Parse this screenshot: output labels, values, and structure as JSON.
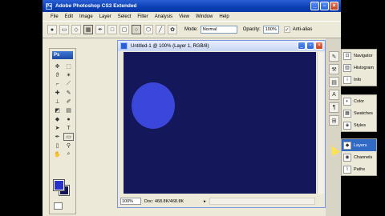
{
  "window": {
    "title": "Adobe Photoshop CS3 Extended",
    "app_icon": "Ps"
  },
  "menu": [
    "File",
    "Edit",
    "Image",
    "Layer",
    "Select",
    "Filter",
    "Analysis",
    "View",
    "Window",
    "Help"
  ],
  "options": {
    "mode_label": "Mode:",
    "mode_value": "Normal",
    "opacity_label": "Opacity:",
    "opacity_value": "100%",
    "antialias_label": "Anti-alias"
  },
  "toolbox": {
    "logo": "Ps",
    "fg_color": "#2a31c8",
    "bg_color": "#101358"
  },
  "document": {
    "title": "Untitled-1 @ 100% (Layer 1, RGB/8)",
    "zoom": "100%",
    "doc_size": "Doc: 468.8K/468.8K",
    "canvas_color": "#14185a",
    "circle_color": "#3a47da"
  },
  "panels": {
    "group1": [
      "Navigator",
      "Histogram",
      "Info"
    ],
    "group2": [
      "Color",
      "Swatches",
      "Styles"
    ],
    "group3": [
      "Layers",
      "Channels",
      "Paths"
    ]
  }
}
